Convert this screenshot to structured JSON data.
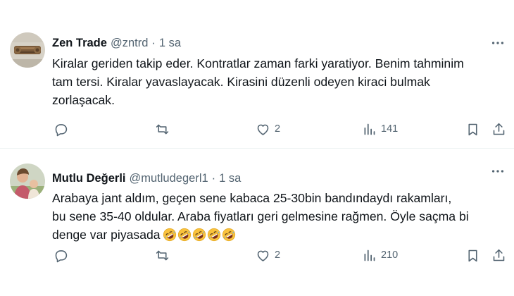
{
  "tweets": [
    {
      "display_name": "Zen Trade",
      "handle": "@zntrd",
      "separator": "·",
      "time": "1 sa",
      "text_lines": [
        "Kiralar geriden takip eder. Kontratlar zaman farki yaratiyor. Benim tahminim",
        "tam tersi. Kiralar yavaslayacak. Kirasini düzenli odeyen kiraci bulmak",
        "zorlaşacak."
      ],
      "likes": "2",
      "views": "141",
      "avatar_icon": "wooden-log-avatar"
    },
    {
      "display_name": "Mutlu Değerli",
      "handle": "@mutludegerl1",
      "separator": "·",
      "time": "1 sa",
      "text_lines": [
        "Arabaya jant aldım, geçen sene kabaca 25-30bin bandındaydı rakamları,",
        "bu sene 35-40 oldular. Araba fiyatları geri gelmesine rağmen. Öyle saçma bi",
        "denge var piyasada"
      ],
      "emoji_count": 5,
      "emoji_icon": "rolling-on-floor-laughing-emoji",
      "likes": "2",
      "views": "210",
      "avatar_icon": "person-photo-avatar"
    }
  ],
  "colors": {
    "text": "#0f1419",
    "secondary": "#536471",
    "divider": "#eff3f4"
  },
  "icons": [
    "reply-icon",
    "repost-icon",
    "like-icon",
    "views-icon",
    "bookmark-icon",
    "share-icon",
    "more-icon"
  ]
}
